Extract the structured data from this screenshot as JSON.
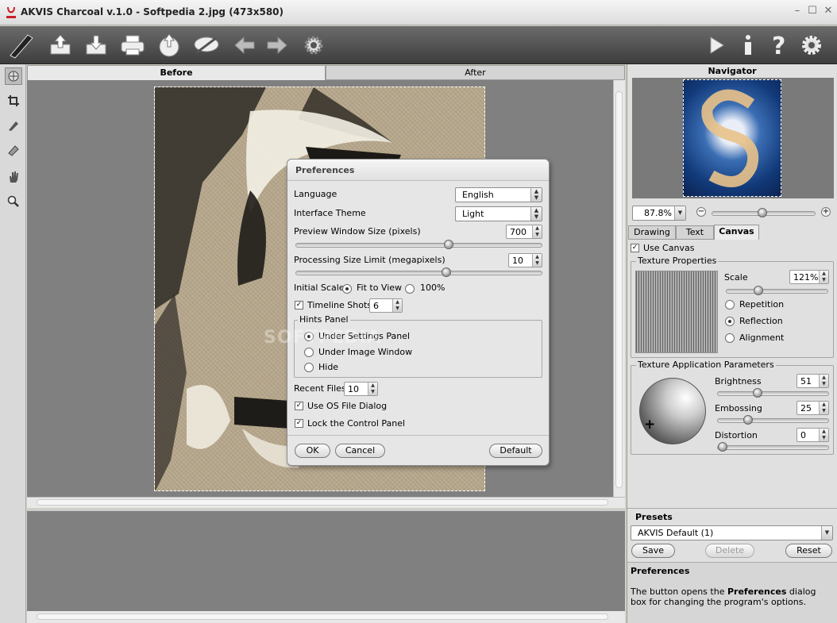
{
  "window": {
    "title": "AKVIS Charcoal v.1.0 - Softpedia 2.jpg (473x580)"
  },
  "toolbar": {
    "left_icons": [
      "charcoal-logo-icon",
      "open-file-icon",
      "save-file-icon",
      "print-icon",
      "share-icon",
      "plugins-icon",
      "undo-icon",
      "redo-icon",
      "preferences-gear-icon"
    ],
    "right_icons": [
      "run-icon",
      "info-icon",
      "help-icon",
      "settings-gear-icon"
    ]
  },
  "tools": [
    "navigate-tool-icon",
    "crop-tool-icon",
    "brush-tool-icon",
    "eraser-tool-icon",
    "hand-tool-icon",
    "zoom-tool-icon"
  ],
  "view_tabs": {
    "before": "Before",
    "after": "After"
  },
  "watermark": "SOFTPEDIA",
  "preferences": {
    "title": "Preferences",
    "language_label": "Language",
    "language_value": "English",
    "theme_label": "Interface Theme",
    "theme_value": "Light",
    "preview_label": "Preview Window Size (pixels)",
    "preview_value": "700",
    "preview_level": 0.61,
    "processing_label": "Processing Size Limit (megapixels)",
    "processing_value": "10",
    "processing_level": 0.6,
    "initial_scale_label": "Initial Scale",
    "fit_to_view": "Fit to View",
    "scale_100": "100%",
    "timeline_label": "Timeline Shots",
    "timeline_value": "6",
    "hints_panel_label": "Hints Panel",
    "hint_under_settings": "Under Settings Panel",
    "hint_under_image": "Under Image Window",
    "hint_hide": "Hide",
    "recent_files_label": "Recent Files",
    "recent_files_value": "10",
    "os_dialog_label": "Use OS File Dialog",
    "lock_panel_label": "Lock the Control Panel",
    "ok": "OK",
    "cancel": "Cancel",
    "default": "Default"
  },
  "navigator": {
    "title": "Navigator",
    "zoom": "87.8%",
    "zoom_out": "−",
    "zoom_in": "+"
  },
  "settings_tabs": {
    "drawing": "Drawing",
    "text": "Text",
    "canvas": "Canvas"
  },
  "canvas": {
    "use_canvas": "Use Canvas",
    "texture_properties": "Texture Properties",
    "scale_label": "Scale",
    "scale_value": "121%",
    "repetition": "Repetition",
    "reflection": "Reflection",
    "alignment": "Alignment",
    "texture_application": "Texture Application Parameters",
    "brightness_label": "Brightness",
    "brightness_value": "51",
    "embossing_label": "Embossing",
    "embossing_value": "25",
    "distortion_label": "Distortion",
    "distortion_value": "0"
  },
  "presets": {
    "title": "Presets",
    "selected": "AKVIS Default (1)",
    "save": "Save",
    "delete": "Delete",
    "reset": "Reset"
  },
  "hints": {
    "title": "Preferences",
    "text_pre": "The button opens the ",
    "text_bold": "Preferences",
    "text_post": " dialog box for changing the program's options."
  }
}
